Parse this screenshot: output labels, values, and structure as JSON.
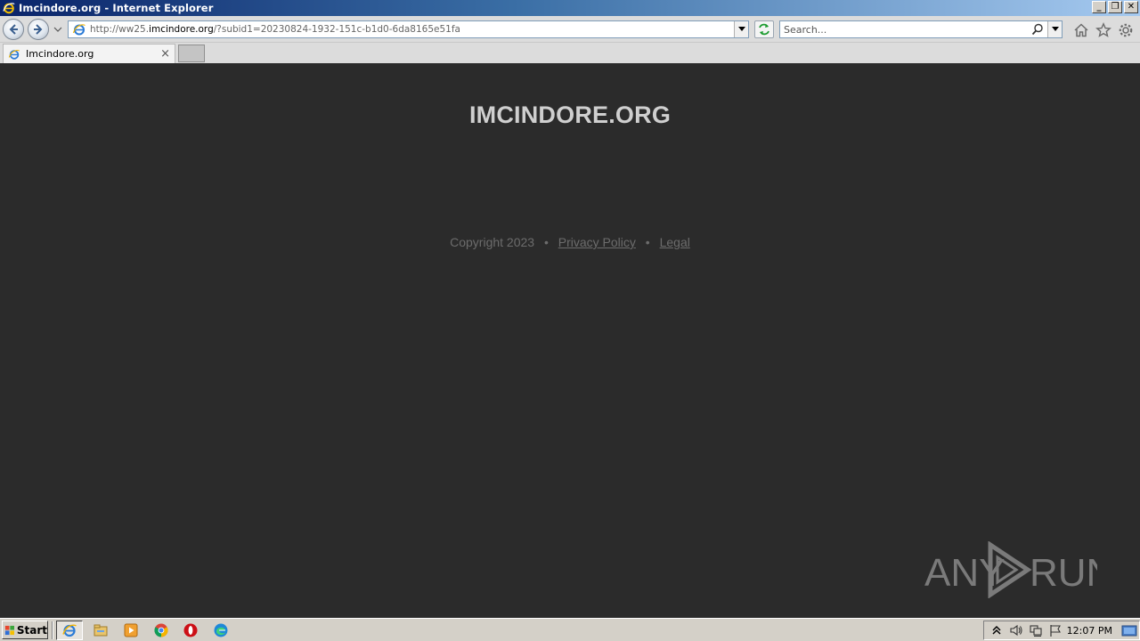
{
  "window": {
    "title": "Imcindore.org - Internet Explorer",
    "controls": [
      "_",
      "❐",
      "✕"
    ]
  },
  "address_bar": {
    "url_prefix": "http://ww25.",
    "url_domain": "imcindore.org",
    "url_suffix": "/?subid1=20230824-1932-151c-b1d0-6da8165e51fa"
  },
  "search": {
    "placeholder": "Search..."
  },
  "tabs": [
    {
      "label": "Imcindore.org",
      "close": "×"
    }
  ],
  "page": {
    "site_title": "IMCINDORE.ORG",
    "copyright": "Copyright 2023",
    "separator": "•",
    "privacy_link": "Privacy Policy",
    "legal_link": "Legal"
  },
  "watermark": {
    "left": "ANY",
    "right": "RUN"
  },
  "taskbar": {
    "start_label": "Start",
    "clock": "12:07 PM",
    "apps": [
      "internet-explorer-icon",
      "file-explorer-icon",
      "media-player-icon",
      "chrome-icon",
      "opera-icon",
      "edge-icon"
    ]
  },
  "colors": {
    "page_bg": "#2b2b2b",
    "title_text": "#cfcfcf",
    "footer_text": "#6c6c6c",
    "titlebar_start": "#0a246a",
    "titlebar_end": "#a6caf0"
  }
}
